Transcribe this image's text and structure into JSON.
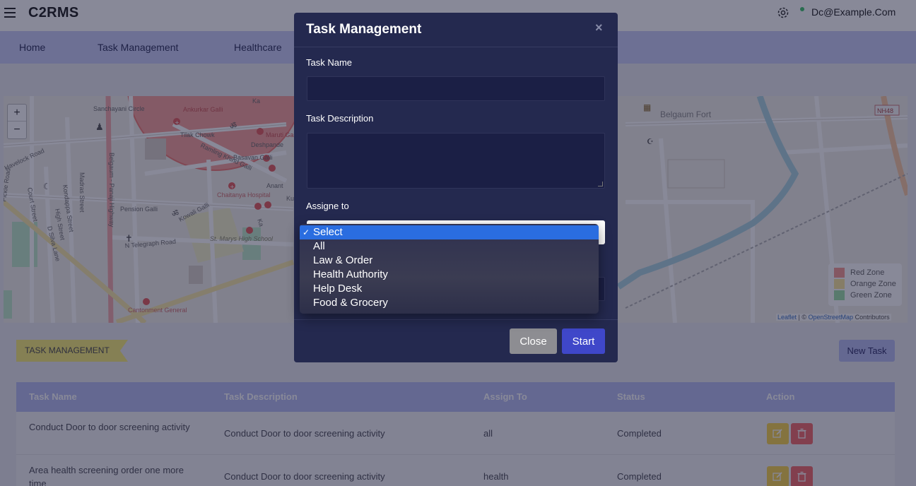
{
  "header": {
    "brand": "C2RMS",
    "user_email": "Dc@Example.Com"
  },
  "nav": {
    "items": [
      "Home",
      "Task Management",
      "Healthcare"
    ]
  },
  "map": {
    "zoom_in": "+",
    "zoom_out": "−",
    "labels": [
      "Sanchayani Circle",
      "Tilak Chowk",
      "Deshpande",
      "Basavan Galli",
      "Ramling Khind Galli",
      "Chaitanya Hospital",
      "Pension Galli",
      "Kowali Galli",
      "N Telegraph Road",
      "St. Marys High School",
      "Cantonment General",
      "Belgaum - Panaji Highway",
      "Madras Street",
      "Kondappa Street",
      "High Street",
      "D Silva Lane",
      "Court Street",
      "Pickle Road",
      "Havelock Road",
      "Belgaum Fort",
      "NH48",
      "Anant",
      "Ku",
      "Ka",
      "Maruti Gal",
      "Ankurkar Galli"
    ],
    "legend": [
      {
        "label": "Red Zone",
        "color": "#f79b93"
      },
      {
        "label": "Orange Zone",
        "color": "#fbe69b"
      },
      {
        "label": "Green Zone",
        "color": "#9fe0a8"
      }
    ],
    "attribution": {
      "leaflet": "Leaflet",
      "sep": " | © ",
      "osm": "OpenStreetMap",
      "suffix": " Contributors"
    }
  },
  "section": {
    "title": "TASK MANAGEMENT",
    "new_task": "New Task"
  },
  "table": {
    "headers": [
      "Task Name",
      "Task Description",
      "Assign To",
      "Status",
      "Action"
    ],
    "rows": [
      {
        "name": "Conduct Door to door screening activity",
        "description": "Conduct Door to door screening activity",
        "assign_to": "all",
        "status": "Completed"
      },
      {
        "name": "Area health screening order one more time",
        "description": "Conduct Door to door screening activity",
        "assign_to": "health",
        "status": "Completed"
      }
    ]
  },
  "modal": {
    "title": "Task Management",
    "close_symbol": "×",
    "task_name_label": "Task Name",
    "task_description_label": "Task Description",
    "assign_label": "Assigne to",
    "close_button": "Close",
    "start_button": "Start",
    "dropdown": {
      "checkmark": "✓",
      "options": [
        "Select",
        "All",
        "Law & Order",
        "Health Authority",
        "Help Desk",
        "Food & Grocery"
      ],
      "selected_index": 0
    }
  },
  "colors": {
    "accent": "#3f47c9",
    "nav_bg": "#c9cdf6",
    "modal_bg": "#24294f",
    "red_zone": "#f07a75"
  }
}
